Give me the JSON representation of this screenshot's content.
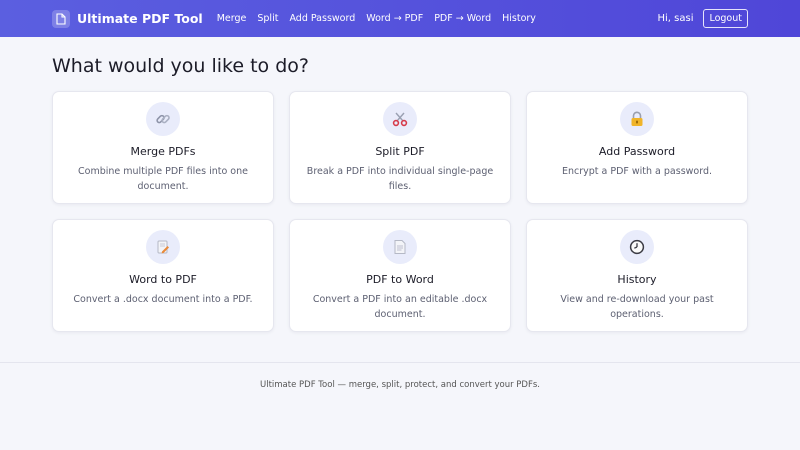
{
  "nav": {
    "brand": "Ultimate PDF Tool",
    "links": [
      "Merge",
      "Split",
      "Add Password",
      "Word → PDF",
      "PDF → Word",
      "History"
    ],
    "greeting": "Hi, sasi",
    "logout_label": "Logout"
  },
  "main": {
    "title": "What would you like to do?",
    "cards": [
      {
        "icon": "link-icon",
        "title": "Merge PDFs",
        "description": "Combine multiple PDF files into one document."
      },
      {
        "icon": "scissors-icon",
        "title": "Split PDF",
        "description": "Break a PDF into individual single-page files."
      },
      {
        "icon": "lock-icon",
        "title": "Add Password",
        "description": "Encrypt a PDF with a password."
      },
      {
        "icon": "pencil-document-icon",
        "title": "Word to PDF",
        "description": "Convert a .docx document into a PDF."
      },
      {
        "icon": "document-icon",
        "title": "PDF to Word",
        "description": "Convert a PDF into an editable .docx document."
      },
      {
        "icon": "clock-icon",
        "title": "History",
        "description": "View and re-download your past operations."
      }
    ]
  },
  "footer": {
    "text": "Ultimate PDF Tool — merge, split, protect, and convert your PDFs."
  },
  "colors": {
    "nav_start": "#5b5fe0",
    "nav_end": "#4f46d8",
    "background": "#f5f6fb",
    "icon_circle": "#e9ecfb"
  }
}
